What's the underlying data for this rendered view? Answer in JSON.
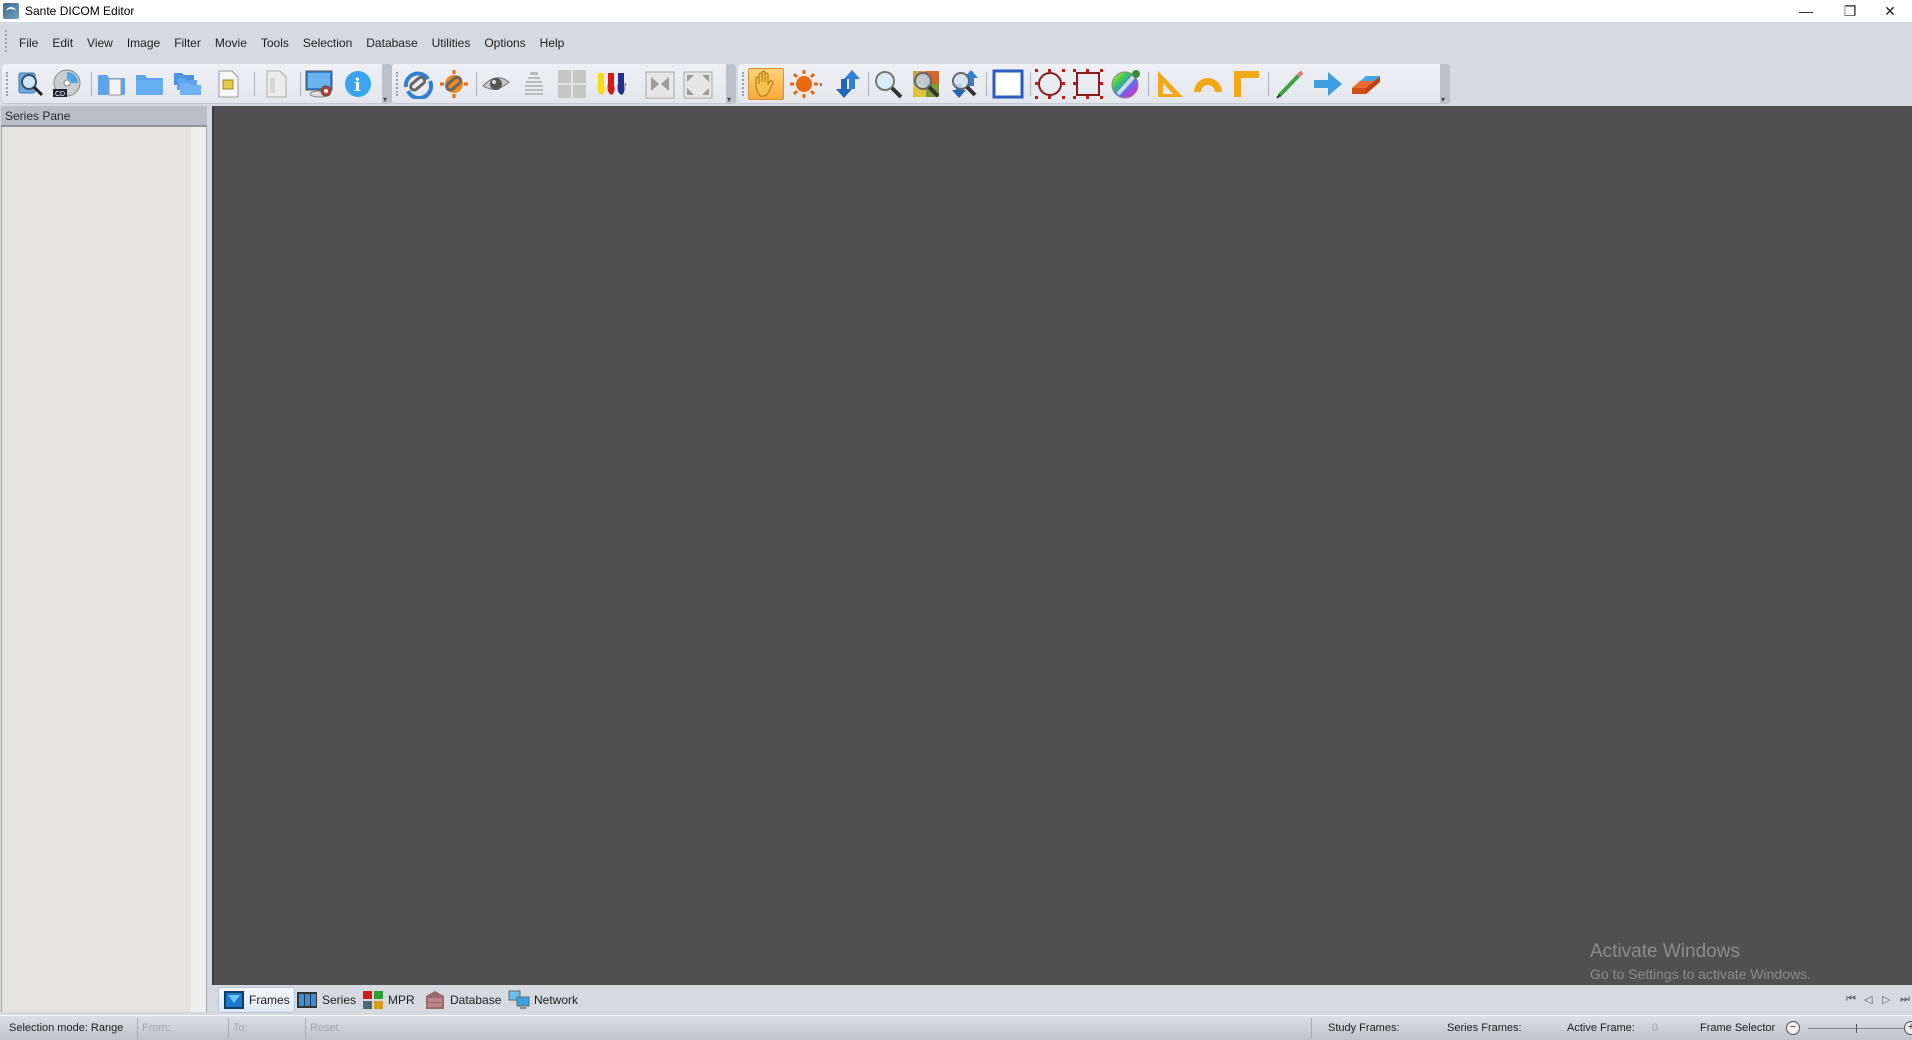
{
  "window": {
    "title": "Sante DICOM Editor",
    "controls": {
      "minimize": "—",
      "restore": "❐",
      "close": "✕"
    }
  },
  "menu": [
    "File",
    "Edit",
    "View",
    "Image",
    "Filter",
    "Movie",
    "Tools",
    "Selection",
    "Database",
    "Utilities",
    "Options",
    "Help"
  ],
  "toolbar": {
    "group1": [
      {
        "name": "search-database-icon",
        "label": "Search"
      },
      {
        "name": "cd-import-icon",
        "label": "Open CD"
      },
      {
        "name": "open-file-icon",
        "label": "Open File"
      },
      {
        "name": "open-folder-icon",
        "label": "Open Folder"
      },
      {
        "name": "open-folders-icon",
        "label": "Open Folders"
      },
      {
        "name": "export-image-icon",
        "label": "Export"
      },
      {
        "name": "document-icon",
        "label": "Document"
      },
      {
        "name": "display-settings-icon",
        "label": "Display Settings"
      },
      {
        "name": "info-icon",
        "label": "Information"
      }
    ],
    "group2": [
      {
        "name": "sync-link-icon",
        "label": "Sync Link"
      },
      {
        "name": "sync-brightness-link-icon",
        "label": "Sync Brightness"
      },
      {
        "name": "eye-icon",
        "label": "View"
      },
      {
        "name": "stack-icon",
        "label": "Stack"
      },
      {
        "name": "crosshair-icon",
        "label": "Crosshair"
      },
      {
        "name": "color-palette-icon",
        "label": "Color LUT"
      },
      {
        "name": "fit-window-icon",
        "label": "Fit"
      },
      {
        "name": "full-screen-icon",
        "label": "Full Screen"
      }
    ],
    "group3": [
      {
        "name": "pan-hand-icon",
        "label": "Pan",
        "active": true
      },
      {
        "name": "window-level-icon",
        "label": "Window/Level"
      },
      {
        "name": "scroll-icon",
        "label": "Scroll"
      },
      {
        "name": "magnify-icon",
        "label": "Magnify"
      },
      {
        "name": "zoom-region-icon",
        "label": "Zoom Region"
      },
      {
        "name": "zoom-scroll-icon",
        "label": "Zoom Scroll"
      },
      {
        "name": "rectangle-select-icon",
        "label": "Rectangle"
      },
      {
        "name": "ellipse-roi-icon",
        "label": "Ellipse ROI"
      },
      {
        "name": "rectangle-roi-icon",
        "label": "Rectangle ROI"
      },
      {
        "name": "color-picker-icon",
        "label": "Color"
      },
      {
        "name": "angle-ruler-icon",
        "label": "Angle"
      },
      {
        "name": "protractor-icon",
        "label": "Protractor"
      },
      {
        "name": "cobb-angle-icon",
        "label": "Cobb"
      },
      {
        "name": "pencil-icon",
        "label": "Draw"
      },
      {
        "name": "arrow-icon",
        "label": "Arrow"
      },
      {
        "name": "eraser-icon",
        "label": "Eraser"
      }
    ]
  },
  "series_pane": {
    "title": "Series Pane"
  },
  "watermark": {
    "line1": "Activate Windows",
    "line2": "Go to Settings to activate Windows."
  },
  "tabs": [
    {
      "label": "Frames",
      "active": true
    },
    {
      "label": "Series"
    },
    {
      "label": "MPR"
    },
    {
      "label": "Database"
    },
    {
      "label": "Network"
    }
  ],
  "frame_nav": {
    "first": "⏮",
    "prev": "◁",
    "next": "▷",
    "last": "⏭"
  },
  "status": {
    "selection_mode": "Selection mode: Range",
    "from": "From:",
    "to": "To:",
    "reset": "Reset",
    "study_frames": "Study Frames:",
    "series_frames": "Series Frames:",
    "active_frame": "Active Frame:",
    "active_frame_value": "0",
    "frame_selector": "Frame Selector",
    "zoom_out": "−",
    "zoom_in": "+",
    "frame_selector_position": 0.5
  }
}
